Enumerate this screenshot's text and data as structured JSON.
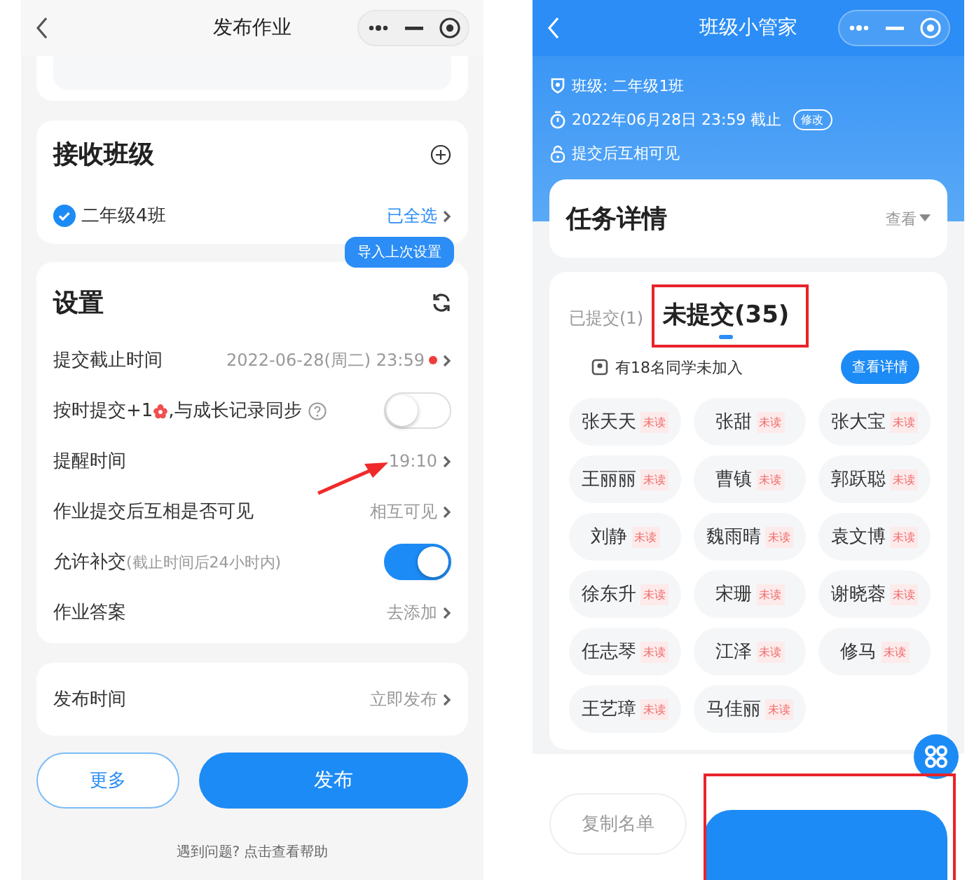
{
  "left_screen": {
    "title": "发布作业",
    "receive_class": {
      "heading": "接收班级",
      "class_name": "二年级4班",
      "checked": true,
      "status": "已全选"
    },
    "settings": {
      "heading": "设置",
      "tooltip": "导入上次设置",
      "rows": [
        {
          "kind": "value",
          "label": "提交截止时间",
          "value": "2022-06-28(周二) 23:59",
          "alert": true
        },
        {
          "kind": "toggle",
          "label": "按时提交+1",
          "label_after": ",与成长记录同步",
          "help": true,
          "on": false
        },
        {
          "kind": "value",
          "label": "提醒时间",
          "value": "19:10",
          "alert": false,
          "annotated": true
        },
        {
          "kind": "value",
          "label": "作业提交后互相是否可见",
          "value": "相互可见",
          "alert": false
        },
        {
          "kind": "toggle",
          "label": "允许补交",
          "note": "(截止时间后24小时内)",
          "help": false,
          "on": true
        },
        {
          "kind": "value",
          "label": "作业答案",
          "value": "去添加",
          "alert": false
        }
      ]
    },
    "publish_time": {
      "label": "发布时间",
      "value": "立即发布"
    },
    "buttons": [
      "更多",
      "发布"
    ],
    "help_link": "遇到问题? 点击查看帮助"
  },
  "right_screen": {
    "title": "班级小管家",
    "info": [
      {
        "kind": "class",
        "text": "班级: 二年级1班"
      },
      {
        "kind": "deadline",
        "text": "2022年06月28日 23:59 截止",
        "badge": "修改"
      },
      {
        "kind": "visibility",
        "text": "提交后互相可见"
      }
    ],
    "task_card": {
      "title": "任务详情",
      "toggle": "查看"
    },
    "tabs": [
      {
        "label": "已提交(1)",
        "selected": false,
        "highlighted": false
      },
      {
        "label": "未提交(35)",
        "selected": true,
        "highlighted": true
      }
    ],
    "notice": "有18名同学未加入",
    "details_button": "查看详情",
    "students": [
      {
        "name": "张天天",
        "status": "未读"
      },
      {
        "name": "张甜",
        "status": "未读"
      },
      {
        "name": "张大宝",
        "status": "未读"
      },
      {
        "name": "王丽丽",
        "status": "未读"
      },
      {
        "name": "曹镇",
        "status": "未读"
      },
      {
        "name": "郭跃聪",
        "status": "未读"
      },
      {
        "name": "刘静",
        "status": "未读"
      },
      {
        "name": "魏雨晴",
        "status": "未读"
      },
      {
        "name": "袁文博",
        "status": "未读"
      },
      {
        "name": "徐东升",
        "status": "未读"
      },
      {
        "name": "宋珊",
        "status": "未读"
      },
      {
        "name": "谢晓蓉",
        "status": "未读"
      },
      {
        "name": "任志琴",
        "status": "未读"
      },
      {
        "name": "江泽",
        "status": "未读"
      },
      {
        "name": "修马",
        "status": "未读"
      },
      {
        "name": "王艺璋",
        "status": "未读"
      },
      {
        "name": "马佳丽",
        "status": "未读"
      }
    ],
    "copy_button": "复制名单",
    "primary_highlighted": true
  }
}
